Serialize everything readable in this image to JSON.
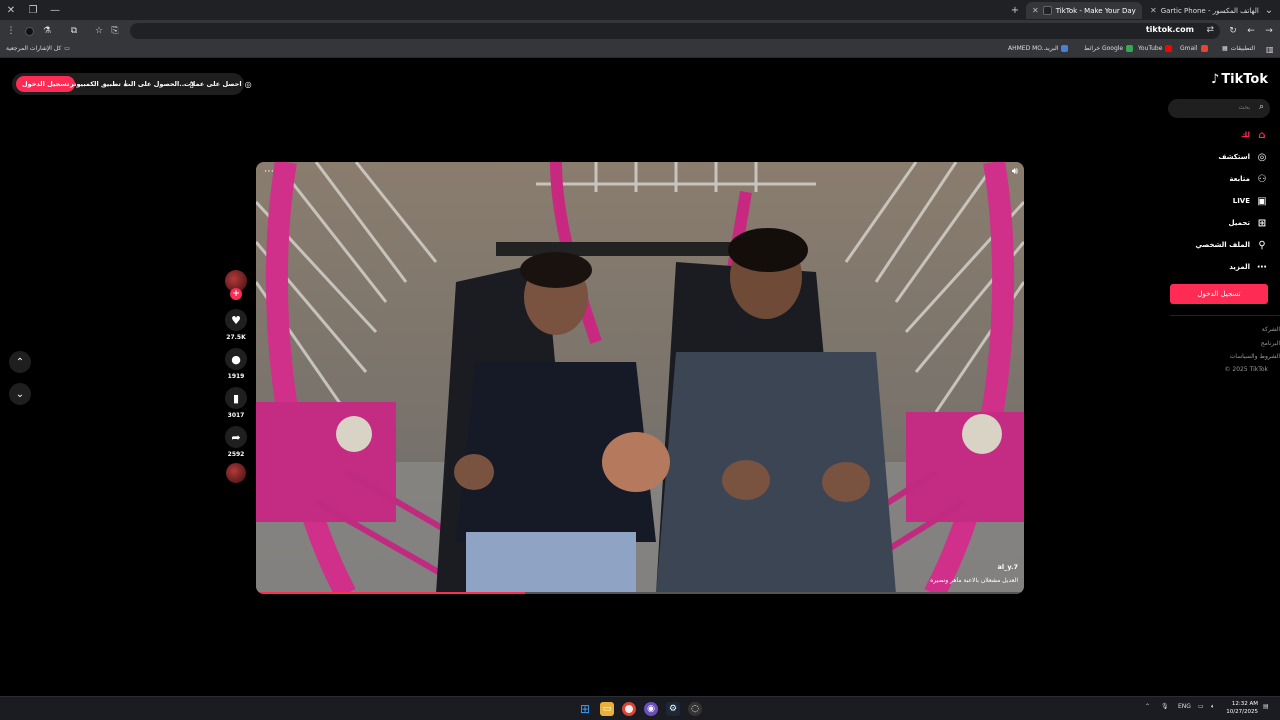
{
  "browser": {
    "tabs": [
      {
        "title": "Gartic Phone - الهاتف المكسور"
      },
      {
        "title": "TikTok - Make Your Day"
      }
    ],
    "url": "tiktok.com",
    "bookmarks": {
      "all_bookmarks": "كل الإشارات المرجعية",
      "items": [
        "AHMED MO...",
        "البريد",
        "خرائط Google",
        "YouTube",
        "Gmail",
        "التطبيقات"
      ]
    }
  },
  "topbar": {
    "login": "تسجيل الدخول",
    "desktop_app": "تطبيق الكمبيوتر",
    "get_app": "الحصول على الت...",
    "get_coins": "احصل على عملات"
  },
  "sidebar": {
    "search_placeholder": "بحث",
    "logo": "TikTok",
    "nav": [
      {
        "label": "لك",
        "icon": "home-icon",
        "active": true
      },
      {
        "label": "استكشف",
        "icon": "compass-icon"
      },
      {
        "label": "متابعة",
        "icon": "following-icon"
      },
      {
        "label": "LIVE",
        "icon": "live-icon"
      },
      {
        "label": "تحميل",
        "icon": "upload-icon"
      },
      {
        "label": "الملف الشخصي",
        "icon": "profile-icon"
      },
      {
        "label": "المزيد",
        "icon": "more-icon"
      }
    ],
    "login_button": "تسجيل الدخول",
    "footer": [
      "الشركة",
      "البرنامج",
      "الشروط والسياسات",
      "© 2025 TikTok"
    ]
  },
  "video": {
    "username": "al_y.7",
    "caption": "العديل مشعلان بالاعبة ماهر ونصيره",
    "progress": 0.35
  },
  "actions": {
    "likes": "27.5K",
    "comments": "1919",
    "saves": "3017",
    "shares": "2592"
  },
  "taskbar": {
    "lang": "ENG",
    "time": "12:32 AM",
    "date": "10/27/2025"
  },
  "colors": {
    "accent": "#fe2c55"
  }
}
